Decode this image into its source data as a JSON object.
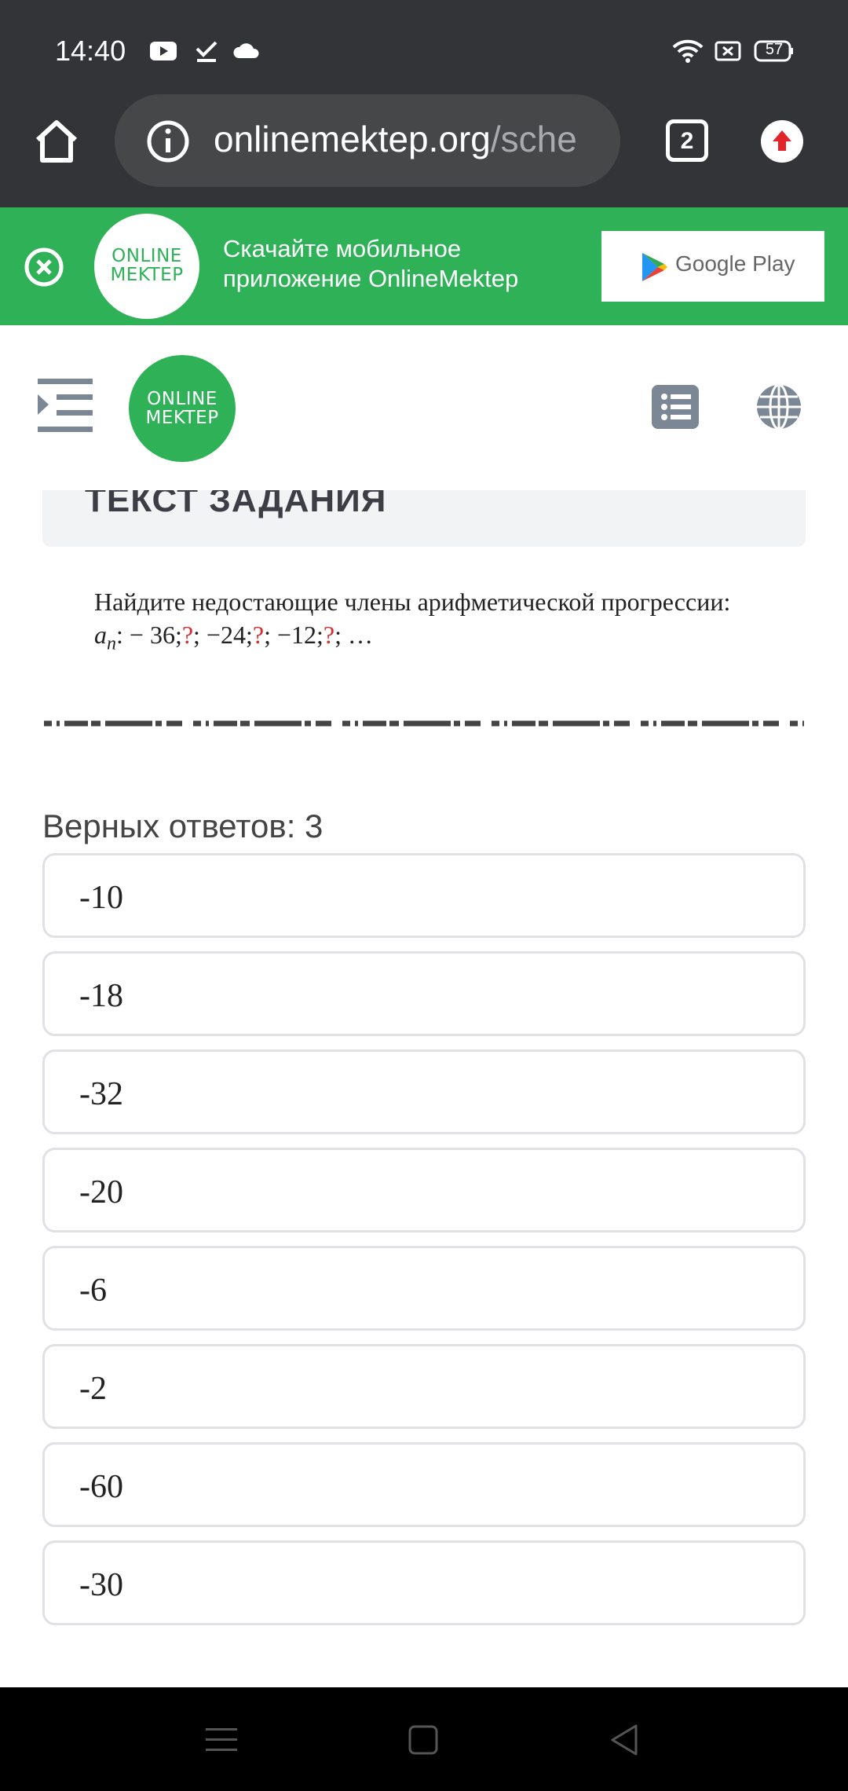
{
  "status": {
    "time": "14:40",
    "battery": "57"
  },
  "browser": {
    "url_main": "onlinemektep.org",
    "url_rest": "/sche",
    "tab_count": "2"
  },
  "promo": {
    "logo_line1": "ONLINE",
    "logo_line2": "MEKTEP",
    "text": "Скачайте мобильное приложение OnlineMektep",
    "store_label": "Google Play"
  },
  "header": {
    "logo_line1": "ONLINE",
    "logo_line2": "MEKTEP"
  },
  "task": {
    "heading": "ТЕКСТ ЗАДАНИЯ",
    "line1": "Найдите недостающие члены арифметической прогрессии:",
    "seq_var": "a",
    "seq_sub": "n",
    "seq_colon": ": − 36;",
    "q": "?",
    "sep1": "; −24;",
    "sep2": "; −12;",
    "end": "; …"
  },
  "answers": {
    "correct_count": "Верных ответов: 3",
    "options": [
      "-10",
      "-18",
      "-32",
      "-20",
      "-6",
      "-2",
      "-60",
      "-30"
    ]
  },
  "colors": {
    "brand_green": "#2fb257",
    "chrome": "#323437",
    "question_mark": "#d32f2f"
  }
}
